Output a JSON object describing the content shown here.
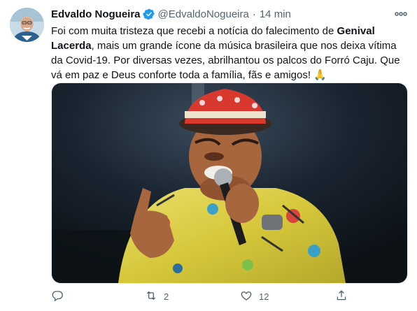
{
  "author": {
    "name": "Edvaldo Nogueira",
    "handle": "@EdvaldoNogueira",
    "time": "14 min"
  },
  "tweet": {
    "seg1": "Foi com muita tristeza que recebi a notícia do falecimento de ",
    "bold": "Genival Lacerda",
    "seg2": ", mais um grande ícone da música brasileira que nos deixa vítima da Covid-19. Por diversas vezes, abrilhantou os palcos do Forró Caju. Que vá em paz e Deus conforte toda a família, fãs e amigos! ",
    "emoji": "🙏"
  },
  "actions": {
    "replies": "",
    "retweets": "2",
    "likes": "12"
  },
  "icons": {
    "verified": "verified-badge-icon",
    "more": "more-options-icon",
    "reply": "reply-icon",
    "retweet": "retweet-icon",
    "like": "heart-icon",
    "share": "share-icon"
  },
  "colors": {
    "verified": "#1d9bf0",
    "secondary_text": "#536471",
    "primary_text": "#0f1419"
  }
}
